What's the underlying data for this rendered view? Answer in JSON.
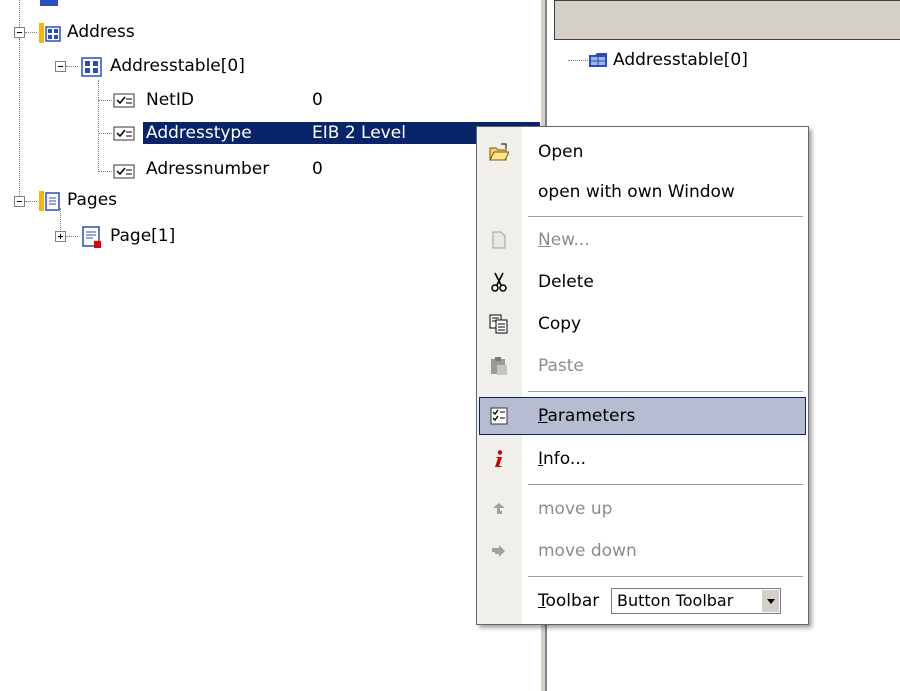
{
  "tree": {
    "nodes": [
      {
        "label": "Address"
      },
      {
        "label": "Addresstable[0]"
      },
      {
        "label": "NetID",
        "value": "0"
      },
      {
        "label": "Addresstype",
        "value": "EIB 2 Level"
      },
      {
        "label": "Adressnumber",
        "value": "0"
      },
      {
        "label": "Pages"
      },
      {
        "label": "Page[1]"
      }
    ]
  },
  "right_pane": {
    "items": [
      {
        "label": "Addresstable[0]"
      }
    ]
  },
  "context_menu": {
    "items": [
      {
        "label": "Open",
        "icon": "open-folder-icon",
        "enabled": true
      },
      {
        "label": "open with own Window",
        "enabled": true
      },
      {
        "label_first": "N",
        "label_rest": "ew...",
        "icon": "new-page-icon",
        "enabled": false
      },
      {
        "label": "Delete",
        "icon": "scissors-icon",
        "enabled": true
      },
      {
        "label": "Copy",
        "icon": "copy-icon",
        "enabled": true
      },
      {
        "label": "Paste",
        "icon": "paste-icon",
        "enabled": false
      },
      {
        "label_first": "P",
        "label_rest": "arameters",
        "icon": "parameters-icon",
        "enabled": true,
        "highlighted": true
      },
      {
        "label_first": "I",
        "label_rest": "nfo...",
        "icon": "info-icon",
        "enabled": true
      },
      {
        "label": "move up",
        "icon": "move-up-icon",
        "enabled": false
      },
      {
        "label": "move down",
        "icon": "move-down-icon",
        "enabled": false
      }
    ],
    "toolbar": {
      "label_first": "T",
      "label_rest": "oolbar",
      "selected": "Button Toolbar"
    }
  },
  "colors": {
    "selection": "#0a246a",
    "menu_highlight": "#b6bdd2",
    "gutter": "#f0efe9"
  }
}
